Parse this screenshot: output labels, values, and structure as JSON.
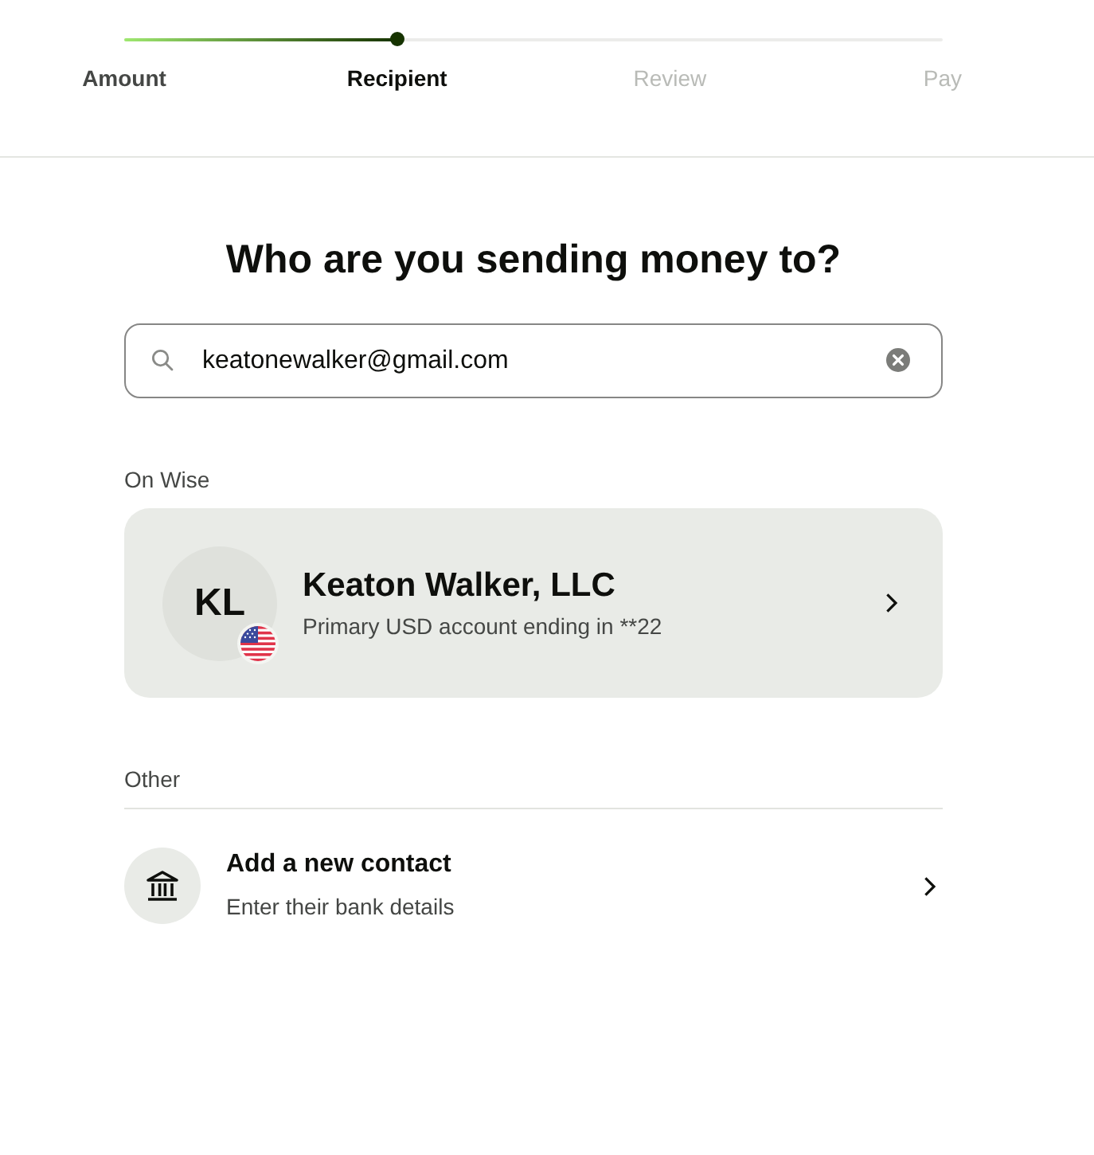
{
  "stepper": {
    "level": 0.333,
    "steps": [
      {
        "label": "Amount",
        "completed": true,
        "selected": false
      },
      {
        "label": "Recipient",
        "completed": false,
        "selected": true
      },
      {
        "label": "Review",
        "completed": false,
        "selected": false
      },
      {
        "label": "Pay",
        "completed": false,
        "selected": false
      }
    ]
  },
  "heading": "Who are you sending money to?",
  "search": {
    "value": "keatonewalker@gmail.com"
  },
  "sections": [
    {
      "title": "On Wise",
      "kind": "recipients",
      "items": [
        {
          "initials": "KL",
          "name": "Keaton Walker, LLC",
          "detail": "Primary USD account ending in **22"
        }
      ]
    },
    {
      "title": "Other",
      "kind": "actions",
      "items": [
        {
          "title": "Add a new contact",
          "detail": "Enter their bank details"
        }
      ]
    }
  ]
}
